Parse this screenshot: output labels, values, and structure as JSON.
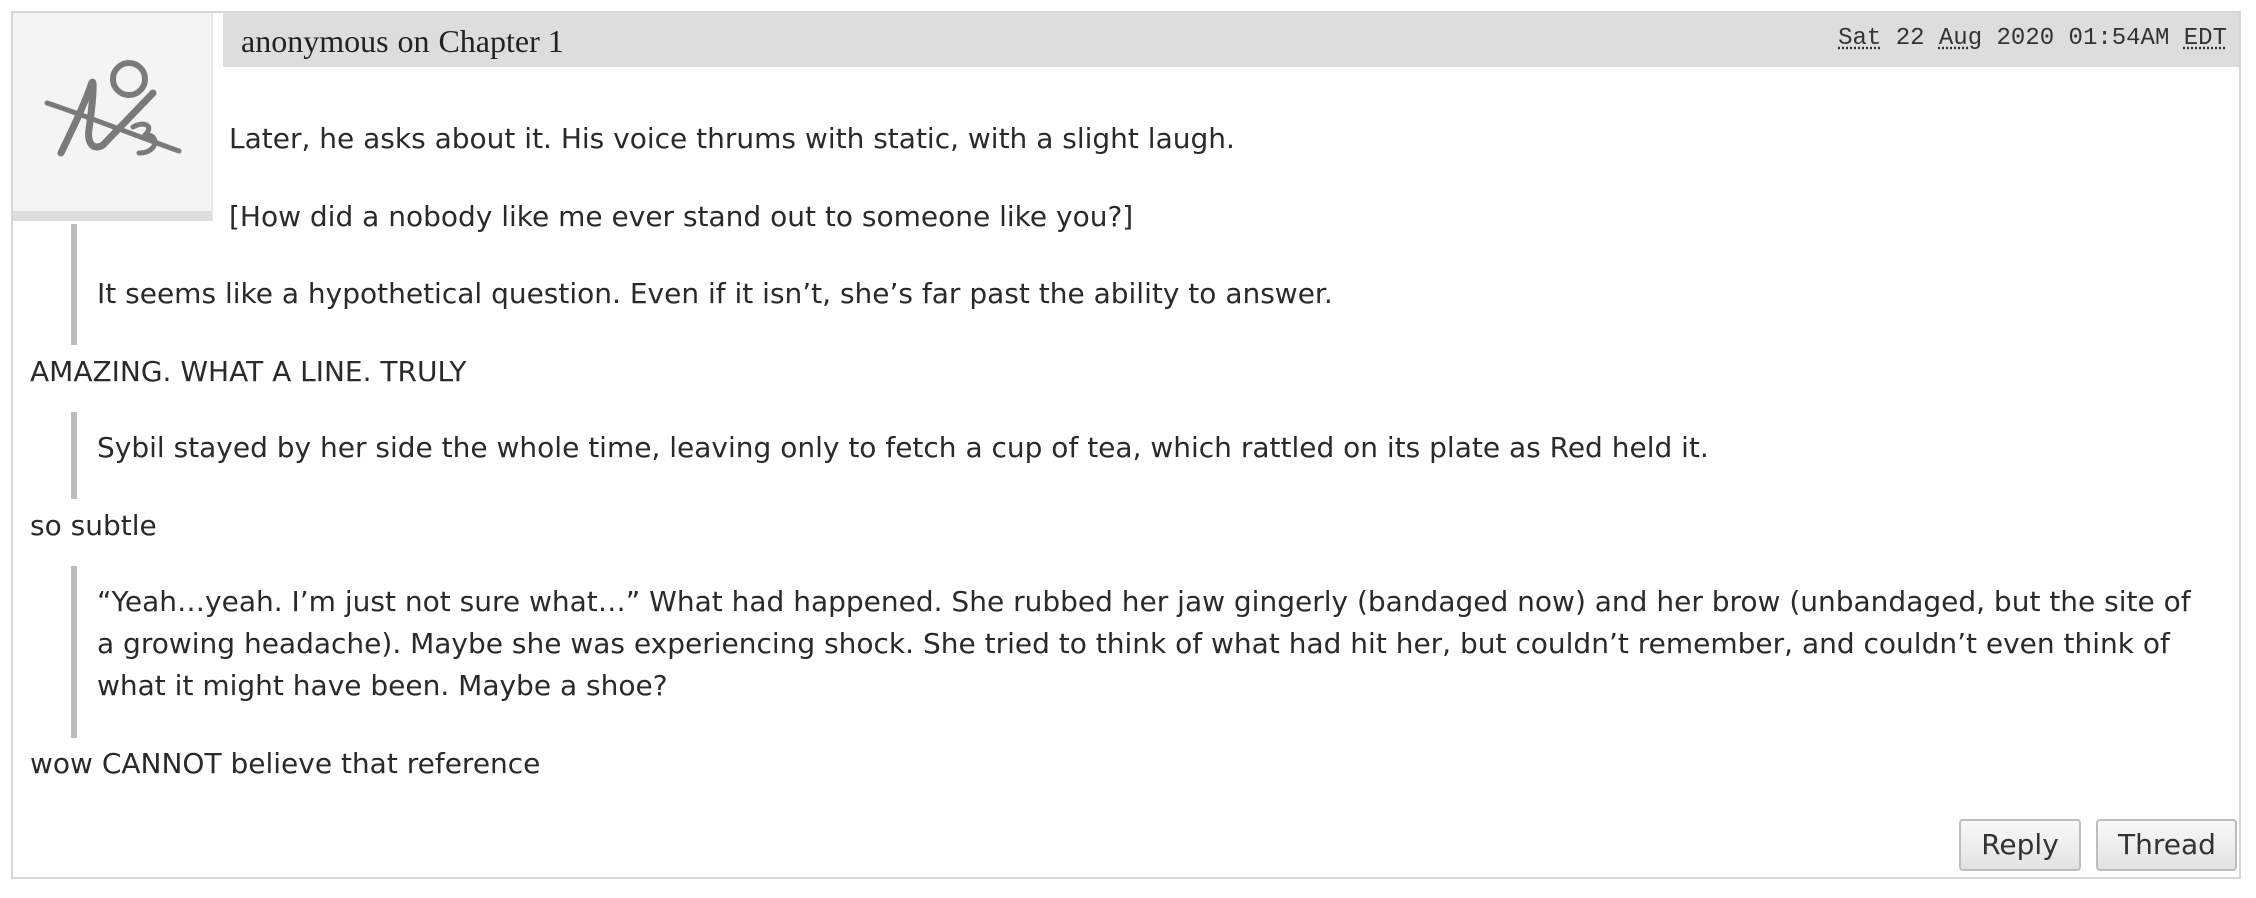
{
  "comment": {
    "author": "anonymous",
    "separator": "on",
    "chapter": "Chapter 1",
    "timestamp": {
      "day": "Sat",
      "date": "22",
      "month": "Aug",
      "year": "2020",
      "time": "01:54AM",
      "tz": "EDT"
    },
    "avatar_icon": "broken-image-placeholder-icon",
    "paragraphs": [
      "Later, he asks about it. His voice thrums with static, with a slight laugh.",
      "[How did a nobody like me ever stand out to someone like you?]"
    ],
    "quotes": [
      "It seems like a hypothetical question. Even if it isn’t, she’s far past the ability to answer.",
      "Sybil stayed by her side the whole time, leaving only to fetch a cup of tea, which rattled on its plate as Red held it.",
      "“Yeah…yeah. I’m just not sure what…” What had happened. She rubbed her jaw gingerly (bandaged now) and her brow (unbandaged, but the site of a growing headache). Maybe she was experiencing shock. She tried to think of what had hit her, but couldn’t remember, and couldn’t even think of what it might have been. Maybe a shoe?"
    ],
    "reactions": [
      "AMAZING. WHAT A LINE. TRULY",
      "so subtle",
      "wow CANNOT believe that reference"
    ]
  },
  "actions": {
    "reply_label": "Reply",
    "thread_label": "Thread"
  }
}
